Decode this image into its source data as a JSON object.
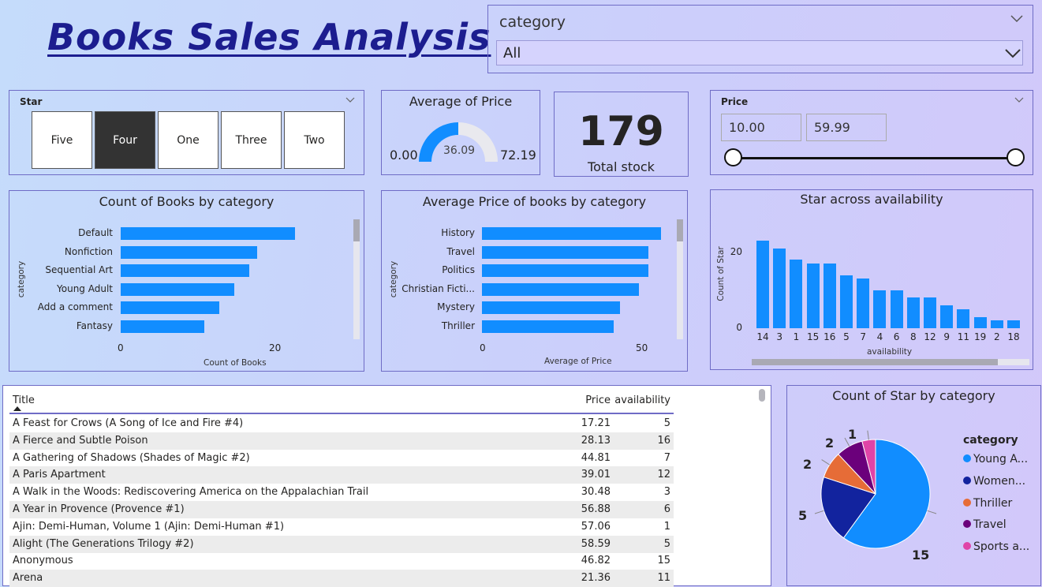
{
  "title": "Books Sales Analysis",
  "category_slicer": {
    "label": "category",
    "value": "All"
  },
  "star_slicer": {
    "label": "Star",
    "options": [
      "Five",
      "Four",
      "One",
      "Three",
      "Two"
    ],
    "selected": "Four"
  },
  "gauge": {
    "title": "Average of Price",
    "min": "0.00",
    "max": "72.19",
    "value_label": "36.09",
    "value": 36.09,
    "max_value": 72.19
  },
  "card": {
    "value": "179",
    "caption": "Total stock"
  },
  "price_slicer": {
    "label": "Price",
    "min": "10.00",
    "max": "59.99"
  },
  "colors": {
    "bar": "#118dff",
    "title": "#1c1d8f",
    "border": "#6f6cc6"
  },
  "chart_data": [
    {
      "type": "bar",
      "title": "Count of Books by category",
      "ylabel": "category",
      "xlabel": "Count of Books",
      "categories": [
        "Default",
        "Nonfiction",
        "Sequential Art",
        "Young Adult",
        "Add a comment",
        "Fantasy"
      ],
      "values": [
        23,
        18,
        17,
        15,
        13,
        11
      ],
      "xticks": [
        "0",
        "20"
      ],
      "xlim": [
        0,
        30
      ]
    },
    {
      "type": "bar",
      "title": "Average Price of books by category",
      "ylabel": "category",
      "xlabel": "Average of Price",
      "categories": [
        "History",
        "Travel",
        "Politics",
        "Christian Ficti...",
        "Mystery",
        "Thriller"
      ],
      "values": [
        57,
        53,
        53,
        50,
        44,
        42
      ],
      "xticks": [
        "0",
        "50"
      ],
      "xlim": [
        0,
        62
      ]
    },
    {
      "type": "bar",
      "title": "Star across availability",
      "ylabel": "Count of Star",
      "xlabel": "availability",
      "categories": [
        "14",
        "3",
        "1",
        "15",
        "16",
        "5",
        "7",
        "4",
        "6",
        "8",
        "12",
        "9",
        "11",
        "19",
        "2",
        "18"
      ],
      "values": [
        23,
        21,
        18,
        17,
        17,
        14,
        13,
        10,
        10,
        8,
        8,
        6,
        5,
        3,
        2,
        2
      ],
      "yticks": [
        "0",
        "20"
      ],
      "ylim": [
        0,
        28
      ]
    },
    {
      "type": "pie",
      "title": "Count of Star by category",
      "legend_title": "category",
      "legend_position": "right",
      "slices": [
        {
          "label": "Young A...",
          "value": 15,
          "color": "#118dff"
        },
        {
          "label": "Women...",
          "value": 5,
          "color": "#12239e"
        },
        {
          "label": "Thriller",
          "value": 2,
          "color": "#e66c37"
        },
        {
          "label": "Travel",
          "value": 2,
          "color": "#6b007b"
        },
        {
          "label": "Sports a...",
          "value": 1,
          "color": "#e044a7"
        }
      ]
    }
  ],
  "table": {
    "headers": [
      "Title",
      "Price",
      "availability"
    ],
    "rows": [
      [
        "A Feast for Crows (A Song of Ice and Fire #4)",
        "17.21",
        "5"
      ],
      [
        "A Fierce and Subtle Poison",
        "28.13",
        "16"
      ],
      [
        "A Gathering of Shadows (Shades of Magic #2)",
        "44.81",
        "7"
      ],
      [
        "A Paris Apartment",
        "39.01",
        "12"
      ],
      [
        "A Walk in the Woods: Rediscovering America on the Appalachian Trail",
        "30.48",
        "3"
      ],
      [
        "A Year in Provence (Provence #1)",
        "56.88",
        "6"
      ],
      [
        "Ajin: Demi-Human, Volume 1 (Ajin: Demi-Human #1)",
        "57.06",
        "1"
      ],
      [
        "Alight (The Generations Trilogy #2)",
        "58.59",
        "5"
      ],
      [
        "Anonymous",
        "46.82",
        "15"
      ],
      [
        "Arena",
        "21.36",
        "11"
      ]
    ]
  }
}
